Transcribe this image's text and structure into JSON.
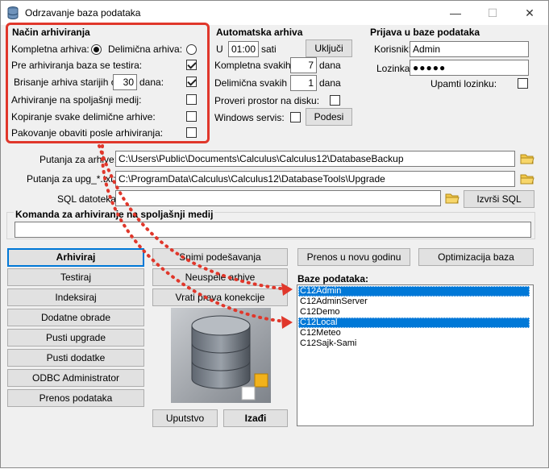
{
  "window": {
    "title": "Odrzavanje baza podataka",
    "minimize": "—",
    "maximize": "☐",
    "close": "✕"
  },
  "nacin": {
    "title": "Način arhiviranja",
    "kompletna_label": "Kompletna arhiva:",
    "kompletna_checked": true,
    "delimicna_label": "Delimična arhiva:",
    "delimicna_checked": false,
    "testira_label": "Pre arhiviranja baza se testira:",
    "testira_checked": true,
    "brisanje_label": "Brisanje arhiva starijih od",
    "brisanje_value": "30",
    "brisanje_unit": "dana:",
    "brisanje_checked": true,
    "spoljasnji_label": "Arhiviranje na spoljašnji medij:",
    "spoljasnji_checked": false,
    "kopiranje_label": "Kopiranje svake delimične arhive:",
    "kopiranje_checked": false,
    "pakovanje_label": "Pakovanje obaviti posle arhiviranja:",
    "pakovanje_checked": false
  },
  "auto": {
    "title": "Automatska arhiva",
    "u_label": "U",
    "time_value": "01:00",
    "sati_label": "sati",
    "ukljuci_button": "Uključi",
    "kompletna_label": "Kompletna svakih",
    "kompletna_value": "7",
    "delimicna_label": "Delimična svakih",
    "delimicna_value": "1",
    "dana_label": "dana",
    "proveri_label": "Proveri prostor na disku:",
    "proveri_checked": false,
    "windows_label": "Windows servis:",
    "windows_checked": false,
    "podesi_button": "Podesi"
  },
  "prijava": {
    "title": "Prijava u baze podataka",
    "korisnik_label": "Korisnik:",
    "korisnik_value": "Admin",
    "lozinka_label": "Lozinka:",
    "lozinka_value": "●●●●●",
    "upamti_label": "Upamti lozinku:",
    "upamti_checked": false
  },
  "paths": {
    "putanja_label": "Putanja za arhive:",
    "putanja_value": "C:\\Users\\Public\\Documents\\Calculus\\Calculus12\\DatabaseBackup",
    "upg_label": "Putanja za upg_*.txt:",
    "upg_value": "C:\\ProgramData\\Calculus\\Calculus12\\DatabaseTools\\Upgrade",
    "sql_label": "SQL datoteka:",
    "sql_value": "",
    "izvrsi_button": "Izvrši SQL"
  },
  "komanda": {
    "title": "Komanda za arhiviranje na spoljašnji medij",
    "value": ""
  },
  "buttons": {
    "arhiviraj": "Arhiviraj",
    "testiraj": "Testiraj",
    "indeksiraj": "Indeksiraj",
    "dodatne": "Dodatne obrade",
    "pusti_upgrade": "Pusti upgrade",
    "pusti_dodatke": "Pusti dodatke",
    "odbc": "ODBC Administrator",
    "prenos_podataka": "Prenos podataka",
    "snimi": "Snimi podešavanja",
    "neuspele": "Neuspele arhive",
    "vrati": "Vrati prava konekcije",
    "prenos_godinu": "Prenos u novu godinu",
    "optimizacija": "Optimizacija baza",
    "uputstvo": "Uputstvo",
    "izadji": "Izađi"
  },
  "baze": {
    "title": "Baze podataka:",
    "items": [
      {
        "name": "C12Admin",
        "selected": true
      },
      {
        "name": "C12AdminServer",
        "selected": false
      },
      {
        "name": "C12Demo",
        "selected": false
      },
      {
        "name": "C12Local",
        "selected": true
      },
      {
        "name": "C12Meteo",
        "selected": false
      },
      {
        "name": "C12Sajk-Sami",
        "selected": false
      }
    ]
  },
  "colors": {
    "accent": "#0078d7",
    "annotation": "#e0372b"
  }
}
